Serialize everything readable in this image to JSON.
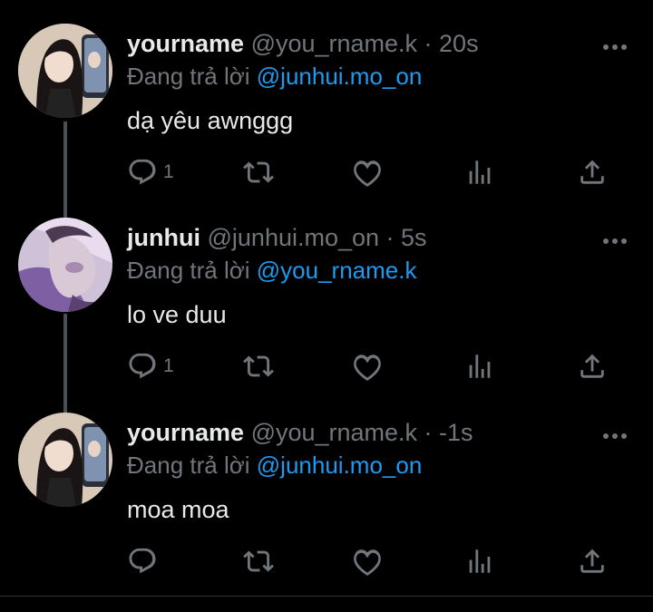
{
  "colors": {
    "background": "#000000",
    "text_primary": "#e7e9ea",
    "text_secondary": "#71767b",
    "accent": "#1d9bf0",
    "thread_line": "#4a4f55"
  },
  "tweets": [
    {
      "display_name": "yourname",
      "handle_time": "@you_rname.k · 20s",
      "reply_prefix": "Đang trả lời ",
      "reply_to": "@junhui.mo_on",
      "text": "dạ yêu awnggg",
      "reply_count": "1",
      "avatar": "girl-portrait"
    },
    {
      "display_name": "junhui",
      "handle_time": "@junhui.mo_on · 5s",
      "reply_prefix": "Đang trả lời ",
      "reply_to": "@you_rname.k",
      "text": "lo ve duu",
      "reply_count": "1",
      "avatar": "purple-portrait"
    },
    {
      "display_name": "yourname",
      "handle_time": "@you_rname.k · -1s",
      "reply_prefix": "Đang trả lời ",
      "reply_to": "@junhui.mo_on",
      "text": "moa moa",
      "reply_count": "",
      "avatar": "girl-portrait"
    }
  ],
  "icons": {
    "reply": "reply-icon",
    "retweet": "retweet-icon",
    "like": "heart-icon",
    "views": "analytics-icon",
    "share": "share-icon",
    "more": "more-icon"
  }
}
